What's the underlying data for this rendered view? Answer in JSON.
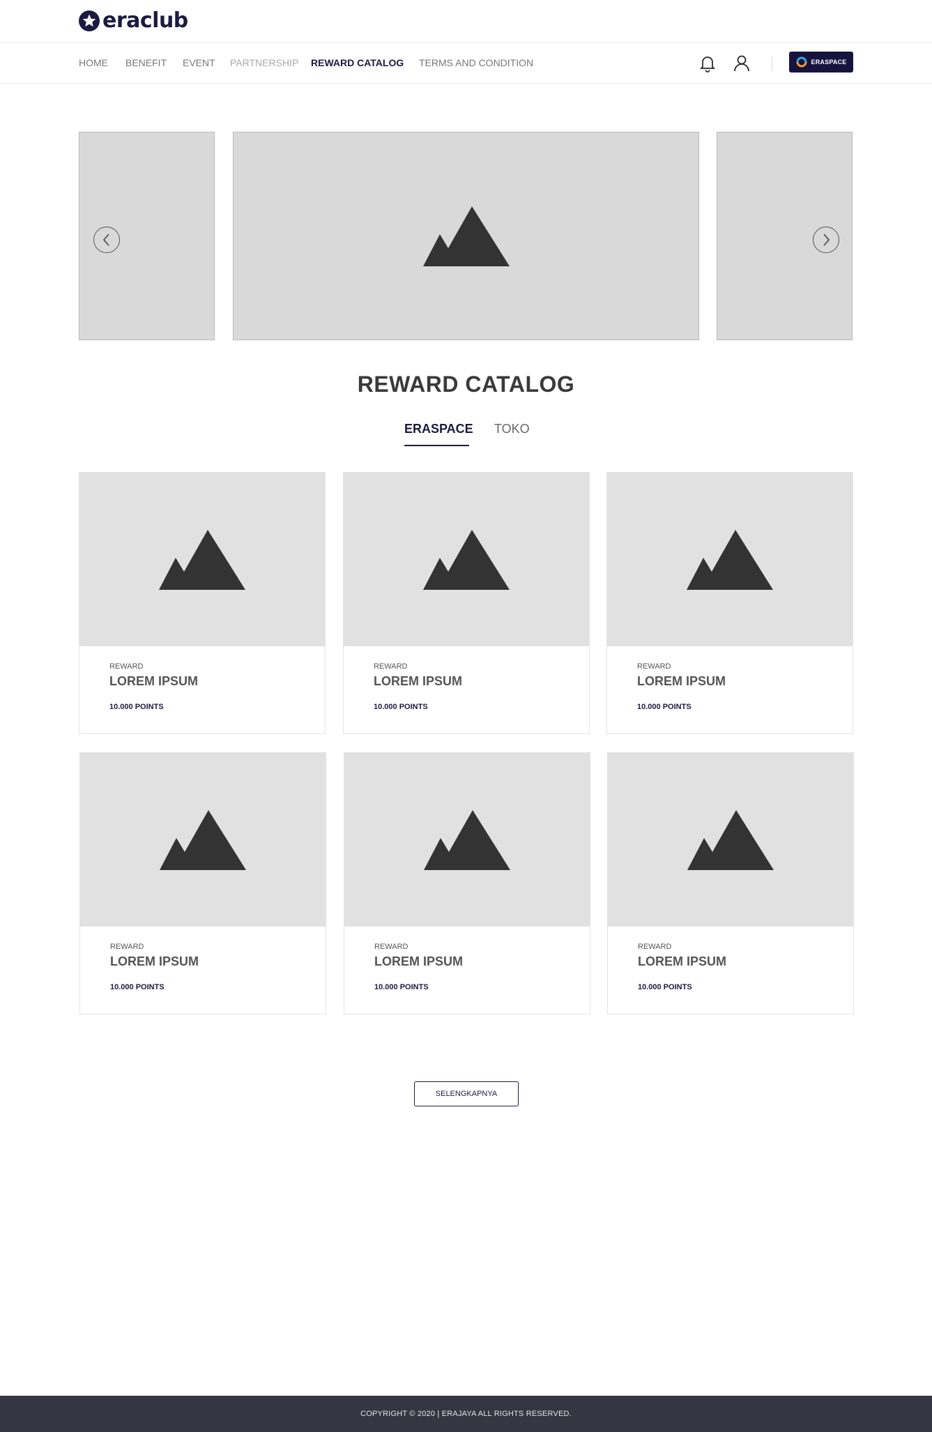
{
  "brand": {
    "logo_text": "eraclub",
    "primary_color": "#1c1a3f",
    "footer_color": "#343641"
  },
  "nav": {
    "items": [
      {
        "label": "HOME"
      },
      {
        "label": "BENEFIT"
      },
      {
        "label": "EVENT"
      },
      {
        "label": "PARTNERSHIP"
      },
      {
        "label": "REWARD CATALOG",
        "active": true
      },
      {
        "label": "TERMS AND CONDITION"
      }
    ],
    "icons": [
      "bell-icon",
      "user-icon"
    ],
    "eraspace_button": "ERASPACE"
  },
  "carousel": {
    "prev_icon": "chevron-left-icon",
    "next_icon": "chevron-right-icon"
  },
  "catalog": {
    "title": "REWARD CATALOG",
    "tabs": [
      {
        "label": "ERASPACE",
        "active": true
      },
      {
        "label": "TOKO",
        "active": false
      }
    ],
    "cards": [
      {
        "category": "REWARD",
        "title": "LOREM IPSUM",
        "points": "10.000 POINTS"
      },
      {
        "category": "REWARD",
        "title": "LOREM IPSUM",
        "points": "10.000 POINTS"
      },
      {
        "category": "REWARD",
        "title": "LOREM IPSUM",
        "points": "10.000 POINTS"
      },
      {
        "category": "REWARD",
        "title": "LOREM IPSUM",
        "points": "10.000 POINTS"
      },
      {
        "category": "REWARD",
        "title": "LOREM IPSUM",
        "points": "10.000 POINTS"
      },
      {
        "category": "REWARD",
        "title": "LOREM IPSUM",
        "points": "10.000 POINTS"
      }
    ],
    "more_button": "SELENGKAPNYA"
  },
  "footer": {
    "copyright": "COPYRIGHT © 2020 | ERAJAYA ALL RIGHTS RESERVED."
  }
}
